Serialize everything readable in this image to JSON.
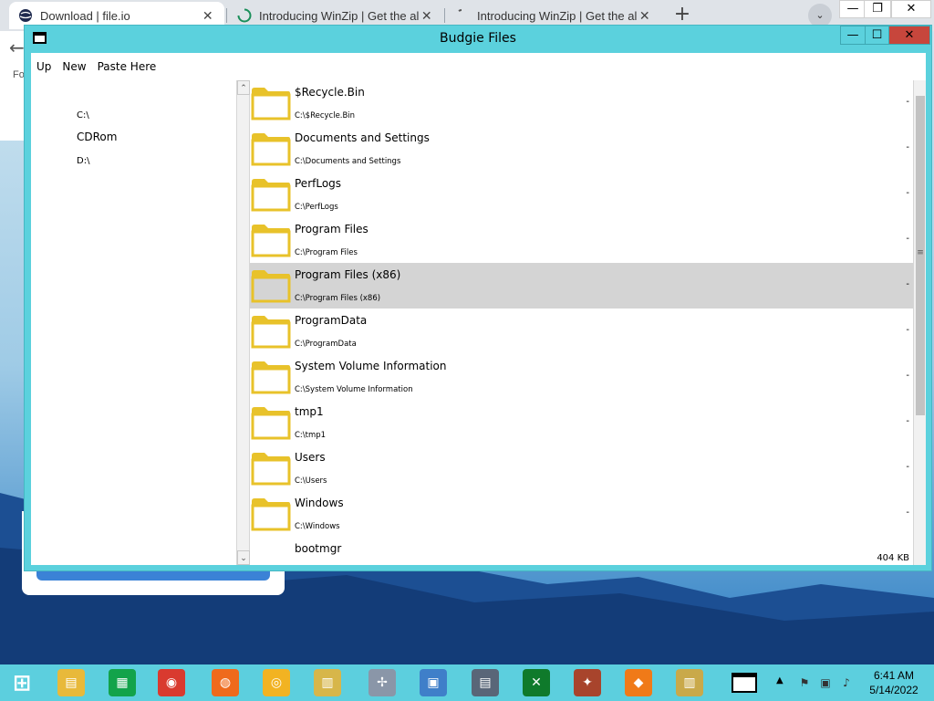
{
  "browser": {
    "tabs": [
      {
        "title": "Download | file.io",
        "icon": "globe-icon",
        "active": true
      },
      {
        "title": "Introducing WinZip | Get the all-i",
        "icon": "loading-spinner-icon",
        "active": false
      },
      {
        "title": "Introducing WinZip | Get the all-i",
        "icon": "loading-spinner-icon",
        "active": false
      }
    ],
    "new_tab_label": "+",
    "tab_search_label": "⌄",
    "controls": {
      "minimize": "—",
      "restore": "❐",
      "close": "✕"
    },
    "page_fragment": "Fo",
    "back_label": "←"
  },
  "window": {
    "title": "Budgie Files",
    "controls": {
      "minimize": "—",
      "maximize": "☐",
      "close": "✕"
    },
    "toolbar": {
      "up": "Up",
      "new": "New",
      "paste": "Paste Here"
    },
    "drives": [
      "C:\\",
      "CDRom",
      "D:\\"
    ],
    "files": [
      {
        "name": "$Recycle.Bin",
        "path": "C:\\$Recycle.Bin",
        "size": "-",
        "type": "folder",
        "selected": false
      },
      {
        "name": "Documents and Settings",
        "path": "C:\\Documents and Settings",
        "size": "-",
        "type": "folder",
        "selected": false
      },
      {
        "name": "PerfLogs",
        "path": "C:\\PerfLogs",
        "size": "-",
        "type": "folder",
        "selected": false
      },
      {
        "name": "Program Files",
        "path": "C:\\Program Files",
        "size": "-",
        "type": "folder",
        "selected": false
      },
      {
        "name": "Program Files (x86)",
        "path": "C:\\Program Files (x86)",
        "size": "-",
        "type": "folder",
        "selected": true
      },
      {
        "name": "ProgramData",
        "path": "C:\\ProgramData",
        "size": "-",
        "type": "folder",
        "selected": false
      },
      {
        "name": "System Volume Information",
        "path": "C:\\System Volume Information",
        "size": "-",
        "type": "folder",
        "selected": false
      },
      {
        "name": "tmp1",
        "path": "C:\\tmp1",
        "size": "-",
        "type": "folder",
        "selected": false
      },
      {
        "name": "Users",
        "path": "C:\\Users",
        "size": "-",
        "type": "folder",
        "selected": false
      },
      {
        "name": "Windows",
        "path": "C:\\Windows",
        "size": "-",
        "type": "folder",
        "selected": false
      },
      {
        "name": "bootmgr",
        "path": "",
        "size": "404 KB",
        "type": "file",
        "selected": false
      }
    ],
    "scroll_up": "⌃",
    "scroll_down": "⌄",
    "scroll_grip": "≡"
  },
  "taskbar": {
    "items": [
      {
        "name": "start-button",
        "icon": "windows-logo-icon",
        "color": "#5ccfde"
      },
      {
        "name": "file-explorer",
        "icon": "folder-icon",
        "color": "#e8b93a"
      },
      {
        "name": "store",
        "icon": "store-icon",
        "color": "#12a34a"
      },
      {
        "name": "chrome",
        "icon": "chrome-icon",
        "color": "#d93a2f"
      },
      {
        "name": "firefox",
        "icon": "firefox-icon",
        "color": "#ef6a1c"
      },
      {
        "name": "vpn",
        "icon": "lock-shield-icon",
        "color": "#f2b322"
      },
      {
        "name": "archive-tool",
        "icon": "archive-icon",
        "color": "#d7b64a"
      },
      {
        "name": "tools",
        "icon": "tools-icon",
        "color": "#8a96a8"
      },
      {
        "name": "control-panel",
        "icon": "control-panel-icon",
        "color": "#3f7fc9"
      },
      {
        "name": "server-manager",
        "icon": "server-icon",
        "color": "#596678"
      },
      {
        "name": "xbox",
        "icon": "xbox-icon",
        "color": "#0f7a2b"
      },
      {
        "name": "game",
        "icon": "game-icon",
        "color": "#a8442c"
      },
      {
        "name": "avast",
        "icon": "avast-icon",
        "color": "#f07a18"
      },
      {
        "name": "winzip",
        "icon": "winzip-icon",
        "color": "#c9a94a"
      },
      {
        "name": "budgie-files",
        "icon": "window-icon",
        "color": "#ffffff"
      }
    ],
    "tray": {
      "chevron": "▲"
    },
    "time": "6:41 AM",
    "date": "5/14/2022"
  }
}
